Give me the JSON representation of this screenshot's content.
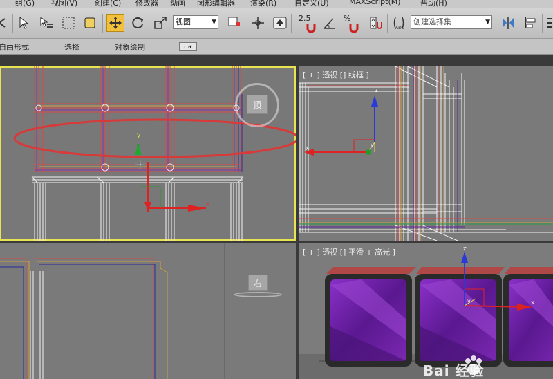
{
  "menu": {
    "items": [
      "组(G)",
      "视图(V)",
      "创建(C)",
      "修改器",
      "动画",
      "图形编辑器",
      "渲染(R)",
      "自定义(U)",
      "MAXScript(M)",
      "帮助(H)"
    ]
  },
  "toolbar": {
    "ref_coord": "视图",
    "angle_snap_value": "2.5",
    "percent_snap_label": "%",
    "selection_set_placeholder": "创建选择集",
    "buttons": [
      "select-object",
      "select-by-name",
      "rect-selection-region",
      "window-crossing",
      "select-and-move",
      "select-and-rotate",
      "select-and-scale",
      "use-pivot-center",
      "select-and-manipulate",
      "keyboard-shortcut-override",
      "snaps-toggle",
      "angle-snap",
      "percent-snap",
      "spinner-snap",
      "edit-named-selection",
      "mirror",
      "align"
    ],
    "active_button": "select-and-move"
  },
  "ribbon": {
    "tabs": [
      "自由形式",
      "选择",
      "对象绘制"
    ]
  },
  "viewports": {
    "top_right": {
      "label": "[ + ] 透视 [] 线框 ]"
    },
    "bottom_right": {
      "label": "[ + ] 透视 [] 平滑 + 高光 ]"
    },
    "top_left_cube": "顶",
    "bottom_left_cube": "右",
    "active": "top_left"
  },
  "axes": {
    "x": "x",
    "y": "y",
    "z": "z"
  },
  "watermark": "Bai 经验",
  "colors": {
    "active_border": "#e8e350",
    "move_active": "#f2c03a",
    "highlight_ellipse": "#d83a3a",
    "box_purple": "#6a1aa0"
  }
}
